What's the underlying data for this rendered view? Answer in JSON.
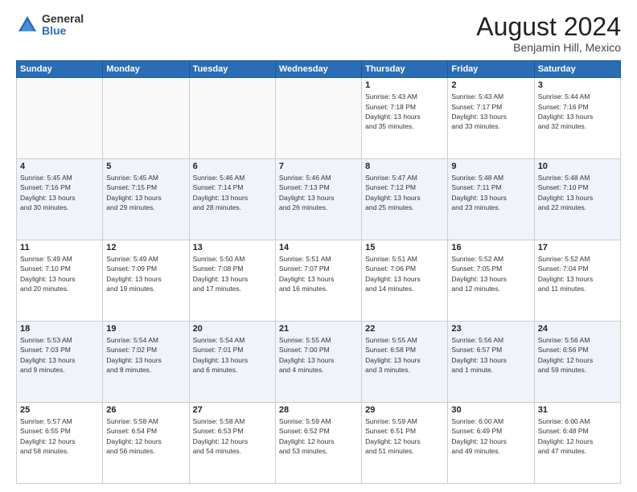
{
  "logo": {
    "general": "General",
    "blue": "Blue"
  },
  "title": "August 2024",
  "location": "Benjamin Hill, Mexico",
  "days_of_week": [
    "Sunday",
    "Monday",
    "Tuesday",
    "Wednesday",
    "Thursday",
    "Friday",
    "Saturday"
  ],
  "weeks": [
    [
      {
        "day": "",
        "info": ""
      },
      {
        "day": "",
        "info": ""
      },
      {
        "day": "",
        "info": ""
      },
      {
        "day": "",
        "info": ""
      },
      {
        "day": "1",
        "info": "Sunrise: 5:43 AM\nSunset: 7:18 PM\nDaylight: 13 hours\nand 35 minutes."
      },
      {
        "day": "2",
        "info": "Sunrise: 5:43 AM\nSunset: 7:17 PM\nDaylight: 13 hours\nand 33 minutes."
      },
      {
        "day": "3",
        "info": "Sunrise: 5:44 AM\nSunset: 7:16 PM\nDaylight: 13 hours\nand 32 minutes."
      }
    ],
    [
      {
        "day": "4",
        "info": "Sunrise: 5:45 AM\nSunset: 7:16 PM\nDaylight: 13 hours\nand 30 minutes."
      },
      {
        "day": "5",
        "info": "Sunrise: 5:45 AM\nSunset: 7:15 PM\nDaylight: 13 hours\nand 29 minutes."
      },
      {
        "day": "6",
        "info": "Sunrise: 5:46 AM\nSunset: 7:14 PM\nDaylight: 13 hours\nand 28 minutes."
      },
      {
        "day": "7",
        "info": "Sunrise: 5:46 AM\nSunset: 7:13 PM\nDaylight: 13 hours\nand 26 minutes."
      },
      {
        "day": "8",
        "info": "Sunrise: 5:47 AM\nSunset: 7:12 PM\nDaylight: 13 hours\nand 25 minutes."
      },
      {
        "day": "9",
        "info": "Sunrise: 5:48 AM\nSunset: 7:11 PM\nDaylight: 13 hours\nand 23 minutes."
      },
      {
        "day": "10",
        "info": "Sunrise: 5:48 AM\nSunset: 7:10 PM\nDaylight: 13 hours\nand 22 minutes."
      }
    ],
    [
      {
        "day": "11",
        "info": "Sunrise: 5:49 AM\nSunset: 7:10 PM\nDaylight: 13 hours\nand 20 minutes."
      },
      {
        "day": "12",
        "info": "Sunrise: 5:49 AM\nSunset: 7:09 PM\nDaylight: 13 hours\nand 19 minutes."
      },
      {
        "day": "13",
        "info": "Sunrise: 5:50 AM\nSunset: 7:08 PM\nDaylight: 13 hours\nand 17 minutes."
      },
      {
        "day": "14",
        "info": "Sunrise: 5:51 AM\nSunset: 7:07 PM\nDaylight: 13 hours\nand 16 minutes."
      },
      {
        "day": "15",
        "info": "Sunrise: 5:51 AM\nSunset: 7:06 PM\nDaylight: 13 hours\nand 14 minutes."
      },
      {
        "day": "16",
        "info": "Sunrise: 5:52 AM\nSunset: 7:05 PM\nDaylight: 13 hours\nand 12 minutes."
      },
      {
        "day": "17",
        "info": "Sunrise: 5:52 AM\nSunset: 7:04 PM\nDaylight: 13 hours\nand 11 minutes."
      }
    ],
    [
      {
        "day": "18",
        "info": "Sunrise: 5:53 AM\nSunset: 7:03 PM\nDaylight: 13 hours\nand 9 minutes."
      },
      {
        "day": "19",
        "info": "Sunrise: 5:54 AM\nSunset: 7:02 PM\nDaylight: 13 hours\nand 8 minutes."
      },
      {
        "day": "20",
        "info": "Sunrise: 5:54 AM\nSunset: 7:01 PM\nDaylight: 13 hours\nand 6 minutes."
      },
      {
        "day": "21",
        "info": "Sunrise: 5:55 AM\nSunset: 7:00 PM\nDaylight: 13 hours\nand 4 minutes."
      },
      {
        "day": "22",
        "info": "Sunrise: 5:55 AM\nSunset: 6:58 PM\nDaylight: 13 hours\nand 3 minutes."
      },
      {
        "day": "23",
        "info": "Sunrise: 5:56 AM\nSunset: 6:57 PM\nDaylight: 13 hours\nand 1 minute."
      },
      {
        "day": "24",
        "info": "Sunrise: 5:56 AM\nSunset: 6:56 PM\nDaylight: 12 hours\nand 59 minutes."
      }
    ],
    [
      {
        "day": "25",
        "info": "Sunrise: 5:57 AM\nSunset: 6:55 PM\nDaylight: 12 hours\nand 58 minutes."
      },
      {
        "day": "26",
        "info": "Sunrise: 5:58 AM\nSunset: 6:54 PM\nDaylight: 12 hours\nand 56 minutes."
      },
      {
        "day": "27",
        "info": "Sunrise: 5:58 AM\nSunset: 6:53 PM\nDaylight: 12 hours\nand 54 minutes."
      },
      {
        "day": "28",
        "info": "Sunrise: 5:59 AM\nSunset: 6:52 PM\nDaylight: 12 hours\nand 53 minutes."
      },
      {
        "day": "29",
        "info": "Sunrise: 5:59 AM\nSunset: 6:51 PM\nDaylight: 12 hours\nand 51 minutes."
      },
      {
        "day": "30",
        "info": "Sunrise: 6:00 AM\nSunset: 6:49 PM\nDaylight: 12 hours\nand 49 minutes."
      },
      {
        "day": "31",
        "info": "Sunrise: 6:00 AM\nSunset: 6:48 PM\nDaylight: 12 hours\nand 47 minutes."
      }
    ]
  ]
}
